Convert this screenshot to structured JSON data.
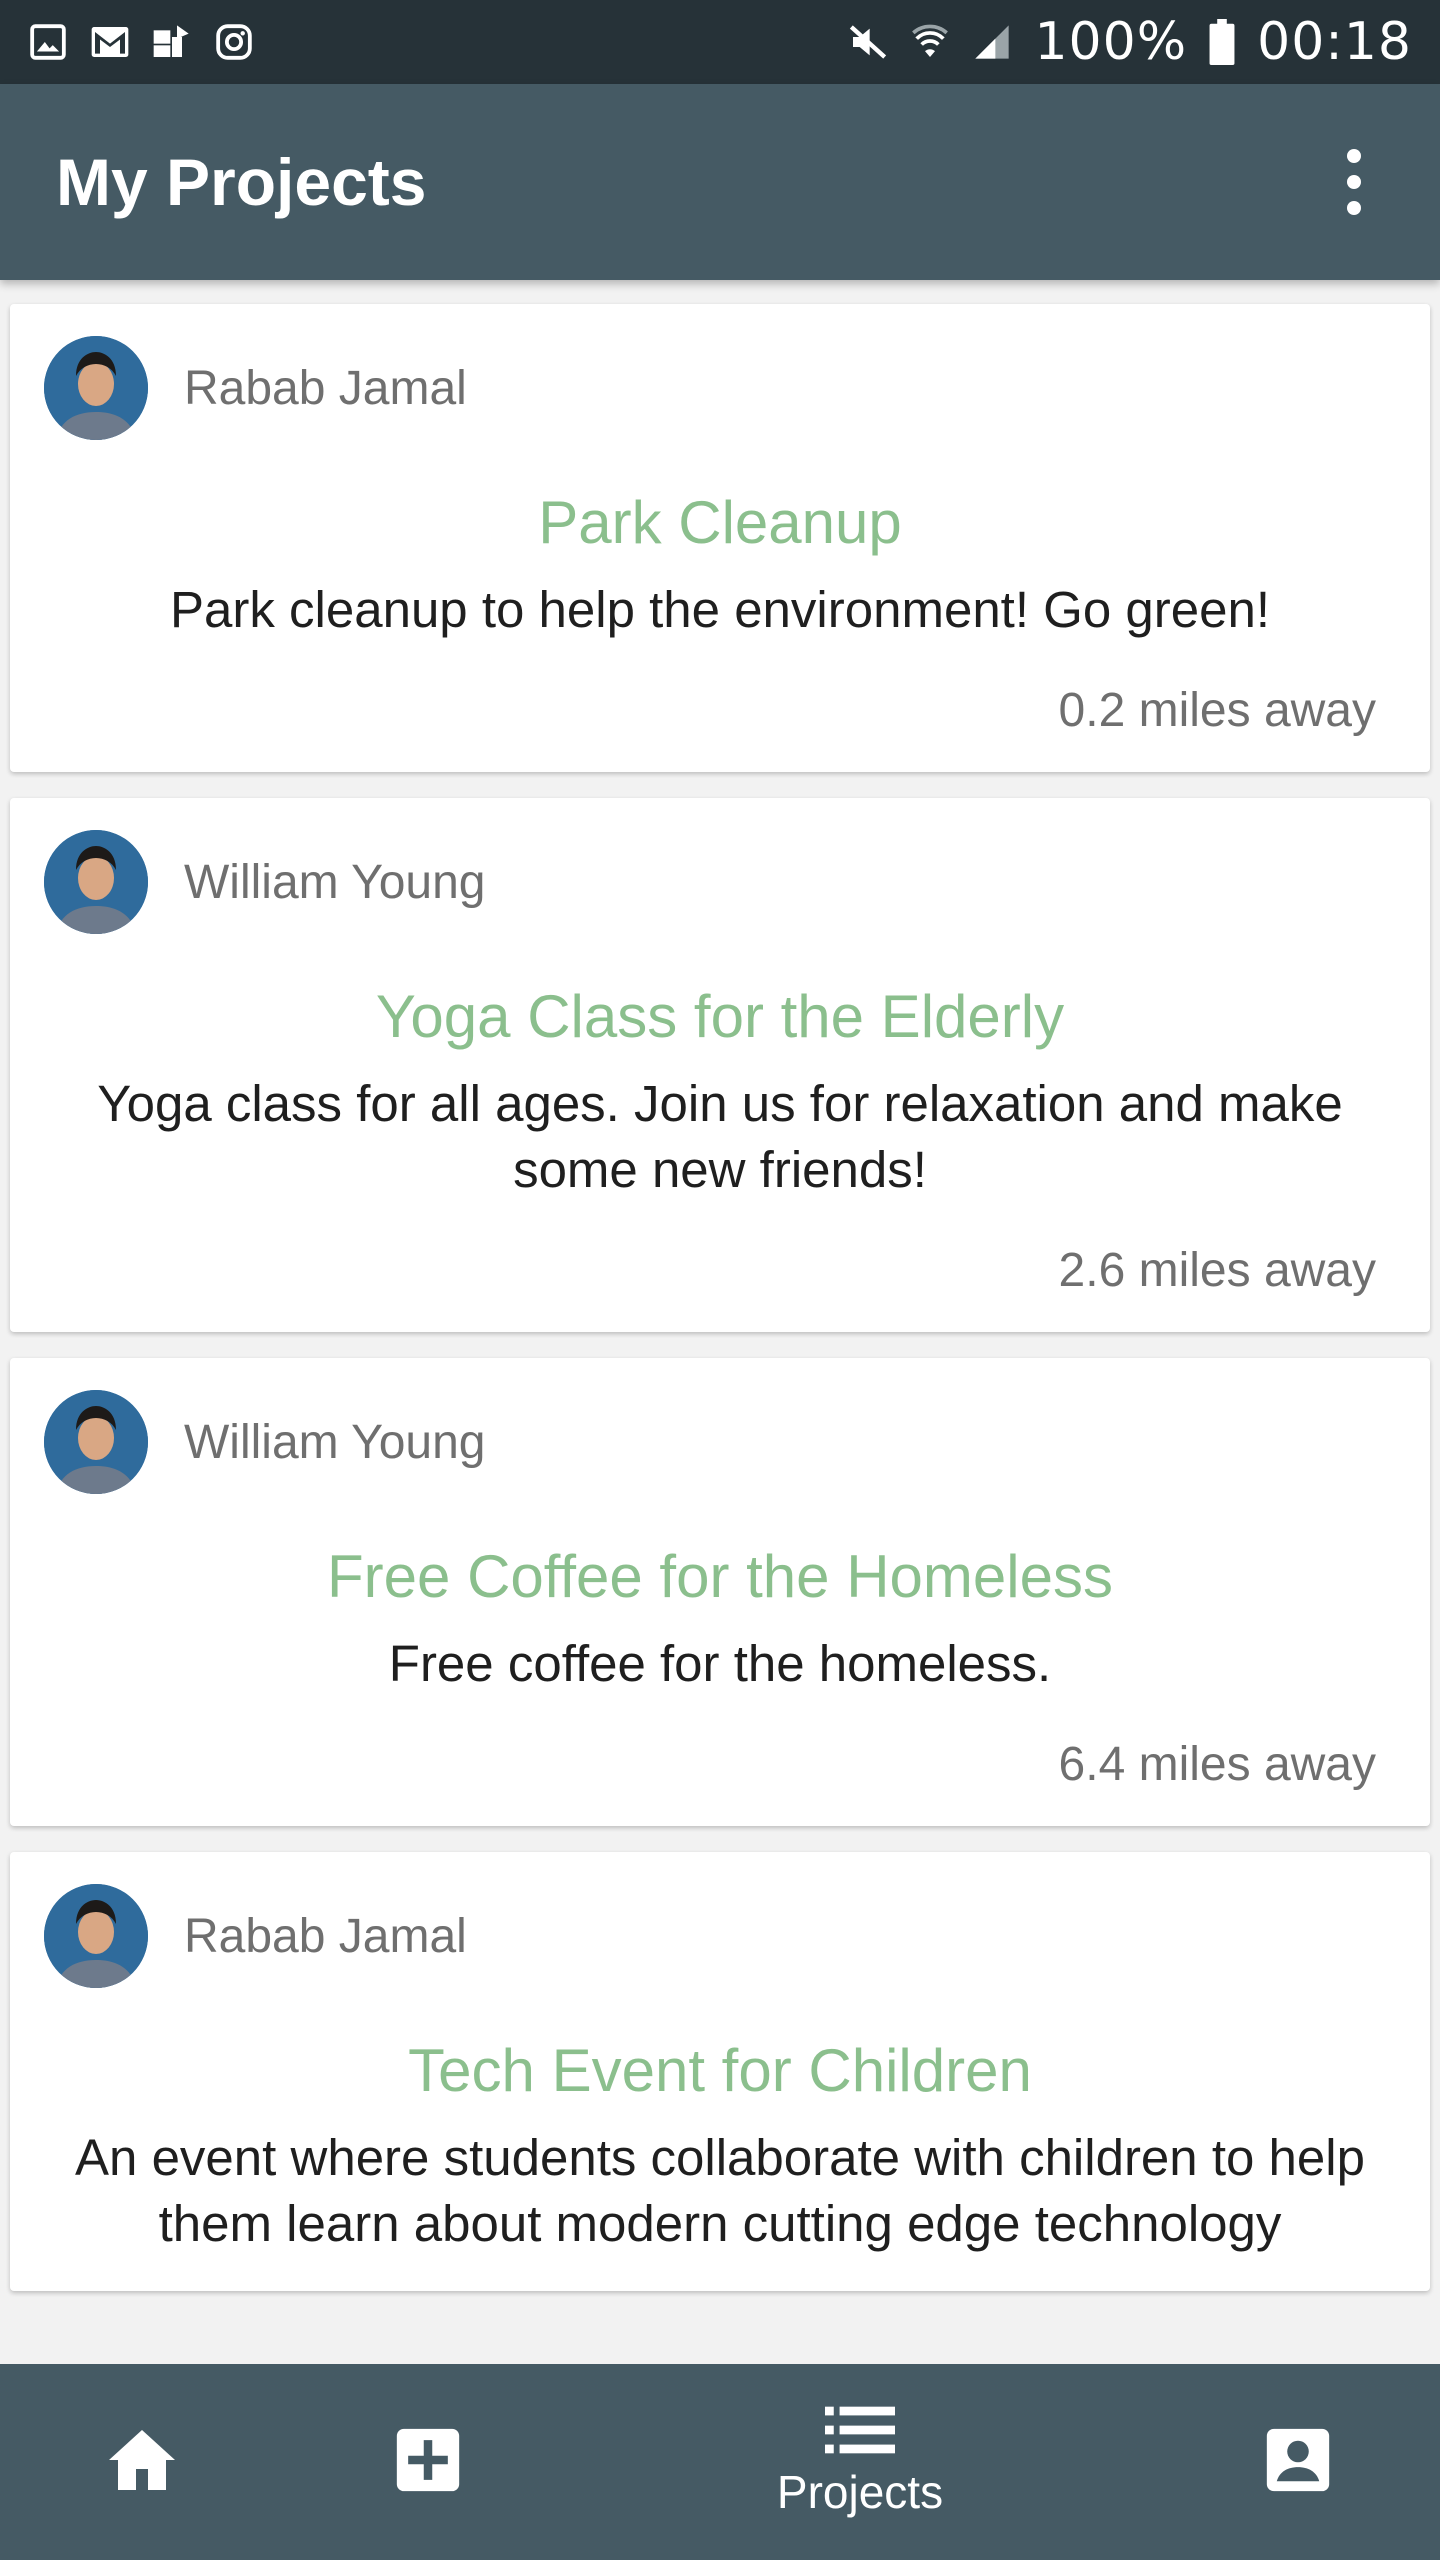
{
  "status_bar": {
    "battery": "100%",
    "time": "00:18"
  },
  "app_bar": {
    "title": "My Projects"
  },
  "projects": [
    {
      "author": "Rabab Jamal",
      "title": "Park Cleanup",
      "description": "Park cleanup to help the environment! Go green!",
      "distance": "0.2 miles away"
    },
    {
      "author": "William Young",
      "title": "Yoga Class for the Elderly",
      "description": "Yoga class for all ages. Join us for relaxation and make some new friends!",
      "distance": "2.6 miles away"
    },
    {
      "author": "William Young",
      "title": "Free Coffee for the Homeless",
      "description": "Free coffee for the homeless.",
      "distance": "6.4 miles away"
    },
    {
      "author": "Rabab Jamal",
      "title": "Tech Event for Children",
      "description": "An event where students collaborate with children to help them learn about modern cutting edge technology",
      "distance": ""
    }
  ],
  "bottom_nav": {
    "projects_label": "Projects"
  },
  "colors": {
    "status_bar": "#263238",
    "app_bar": "#455a64",
    "accent_title": "#8bbf8d"
  }
}
